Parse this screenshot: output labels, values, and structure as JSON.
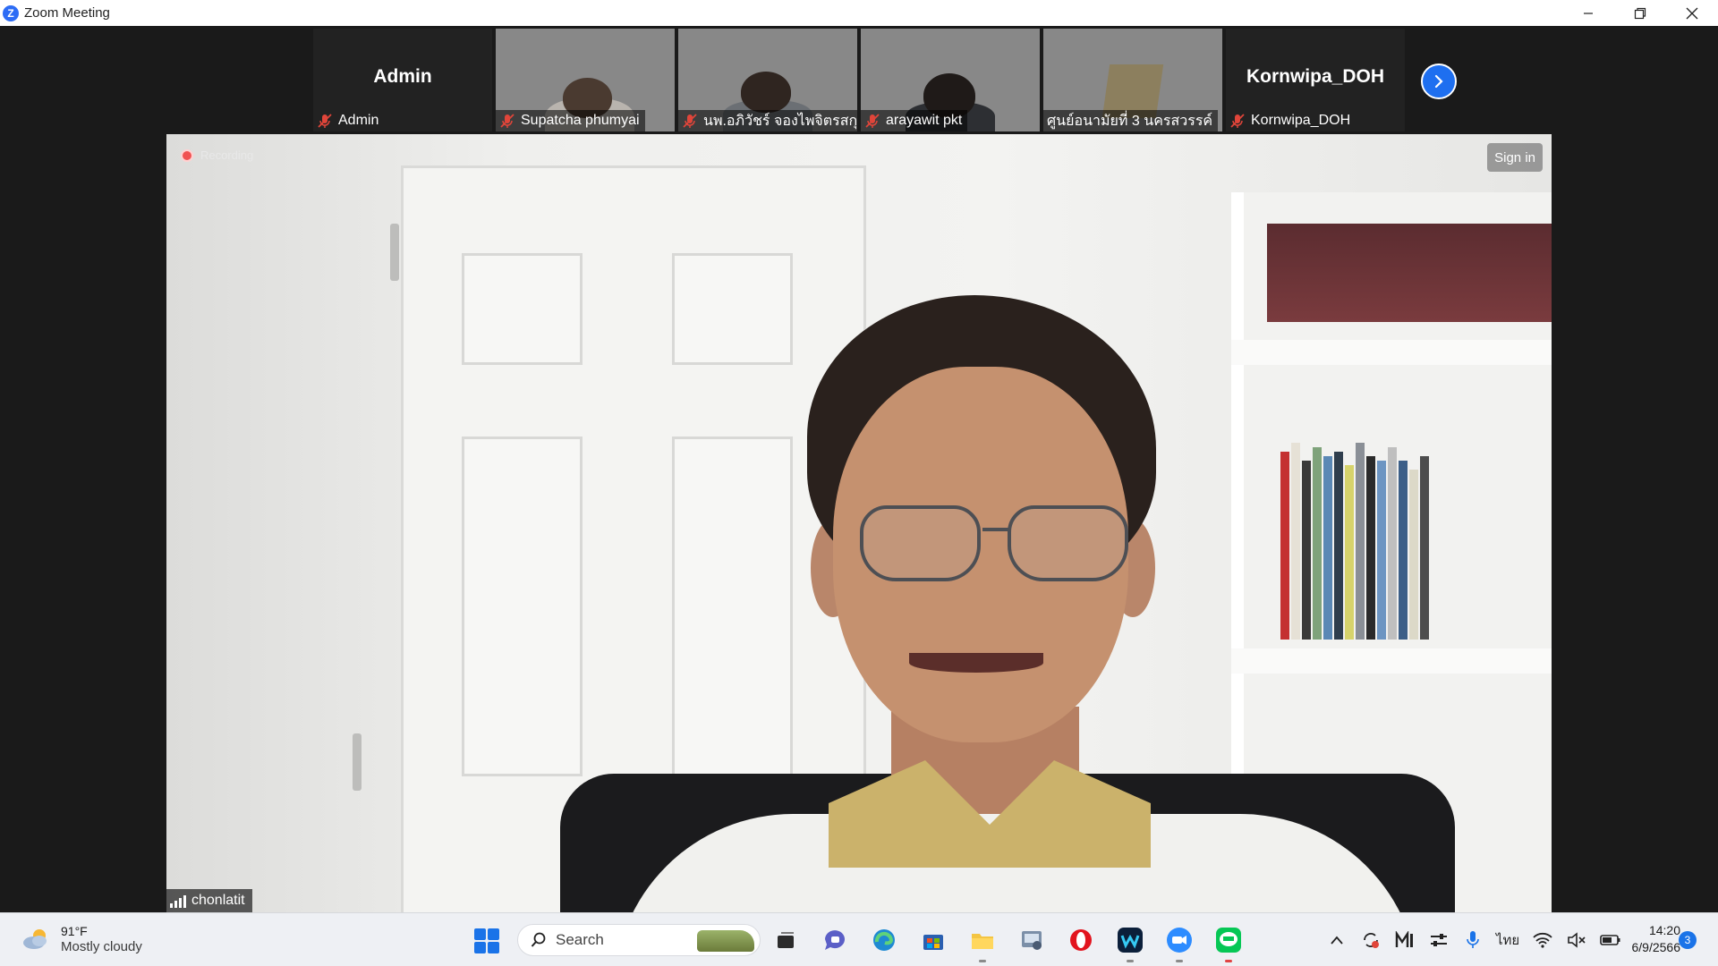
{
  "window": {
    "title": "Zoom Meeting",
    "logo_letter": "Z",
    "controls": [
      "minimize",
      "restore",
      "close"
    ]
  },
  "participants_strip": [
    {
      "name": "Admin",
      "big_name": "Admin",
      "video": false
    },
    {
      "name": "Supatcha phumyai",
      "video": true
    },
    {
      "name": "นพ.อภิวัชร์ จองไพจิตรสกุล",
      "video": true
    },
    {
      "name": "arayawit pkt",
      "video": true
    },
    {
      "name": "ศูนย์อนามัยที่ 3 นครสวรรค์",
      "video": true
    },
    {
      "name": "Kornwipa_DOH",
      "big_name": "Kornwipa_DOH",
      "video": false
    }
  ],
  "main_video": {
    "recording_label": "Recording",
    "sign_in_label": "Sign in",
    "speaker_name": "chonlatit"
  },
  "taskbar": {
    "weather_temp": "91°F",
    "weather_desc": "Mostly cloudy",
    "search_label": "Search",
    "language": "ไทย",
    "time": "14:20",
    "date": "6/9/2566",
    "notification_count": "3"
  },
  "colors": {
    "zoom_blue": "#1e6ff0",
    "mic_muted_red": "#e0453a",
    "recording_red": "#f05252",
    "taskbar_bg": "#eef0f4"
  }
}
